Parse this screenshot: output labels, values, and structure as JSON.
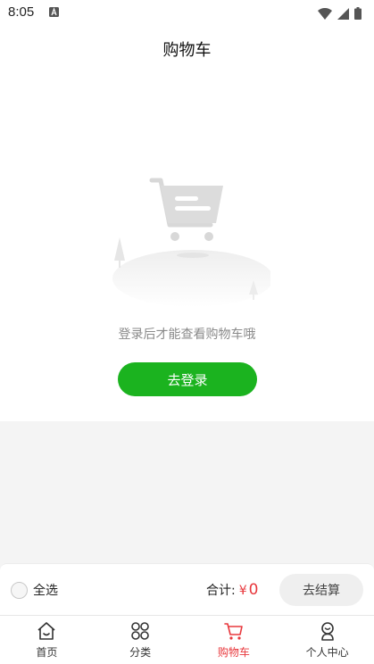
{
  "status_bar": {
    "time": "8:05",
    "icons": [
      "notification-a-icon",
      "wifi-icon",
      "signal-icon",
      "battery-icon"
    ]
  },
  "header": {
    "title": "购物车"
  },
  "empty_state": {
    "illustration": "empty-cart-icon",
    "message": "登录后才能查看购物车哦",
    "login_button_label": "去登录"
  },
  "checkout": {
    "select_all_label": "全选",
    "total_label": "合计:",
    "currency": "¥",
    "amount": "0",
    "checkout_button_label": "去结算"
  },
  "tabs": [
    {
      "label": "首页",
      "icon": "home-icon",
      "active": false
    },
    {
      "label": "分类",
      "icon": "category-icon",
      "active": false
    },
    {
      "label": "购物车",
      "icon": "cart-icon",
      "active": true
    },
    {
      "label": "个人中心",
      "icon": "user-icon",
      "active": false
    }
  ],
  "colors": {
    "accent_green": "#1bb31f",
    "price_red": "#e8383d",
    "active_tab": "#e8383d"
  }
}
